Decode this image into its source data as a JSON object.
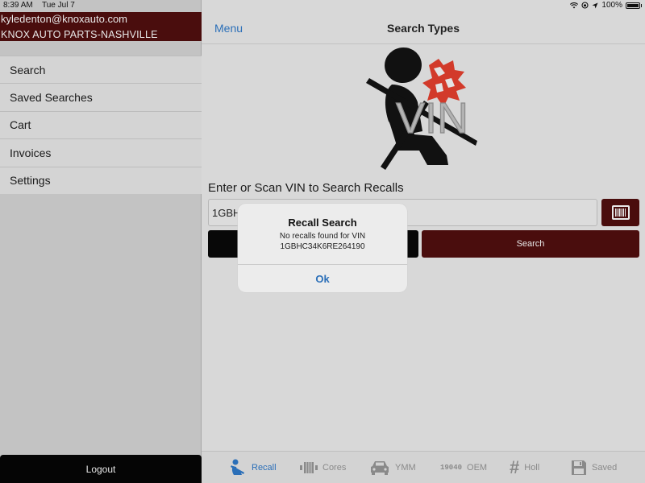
{
  "status_bar": {
    "time": "8:39 AM",
    "date": "Tue Jul 7",
    "battery": "100%"
  },
  "sidebar": {
    "email": "kyledenton@knoxauto.com",
    "store": "KNOX AUTO PARTS-NASHVILLE",
    "items": [
      {
        "label": "Search"
      },
      {
        "label": "Saved Searches"
      },
      {
        "label": "Cart"
      },
      {
        "label": "Invoices"
      },
      {
        "label": "Settings"
      }
    ],
    "logout_label": "Logout"
  },
  "nav": {
    "menu_label": "Menu",
    "title": "Search Types"
  },
  "logo": {
    "text": "VIN"
  },
  "recall": {
    "prompt": "Enter or Scan VIN to Search Recalls",
    "input_value": "1GBH",
    "search_label": "Search"
  },
  "dialog": {
    "title": "Recall Search",
    "message_line1": "No recalls found for VIN",
    "message_line2": "1GBHC34K6RE264190",
    "ok_label": "Ok"
  },
  "tabs": [
    {
      "label": "Recall",
      "icon": "recall-icon",
      "active": true
    },
    {
      "label": "Cores",
      "icon": "cores-icon",
      "active": false
    },
    {
      "label": "YMM",
      "icon": "car-icon",
      "active": false
    },
    {
      "label": "OEM",
      "icon": "oem-icon",
      "icon_text": "19040",
      "active": false
    },
    {
      "label": "Holl",
      "icon": "hash-icon",
      "active": false
    },
    {
      "label": "Saved",
      "icon": "saved-icon",
      "active": false
    }
  ],
  "colors": {
    "brand_dark_red": "#4a0d0d",
    "accent_blue": "#2b6fb8",
    "logo_red": "#d23a2a"
  }
}
